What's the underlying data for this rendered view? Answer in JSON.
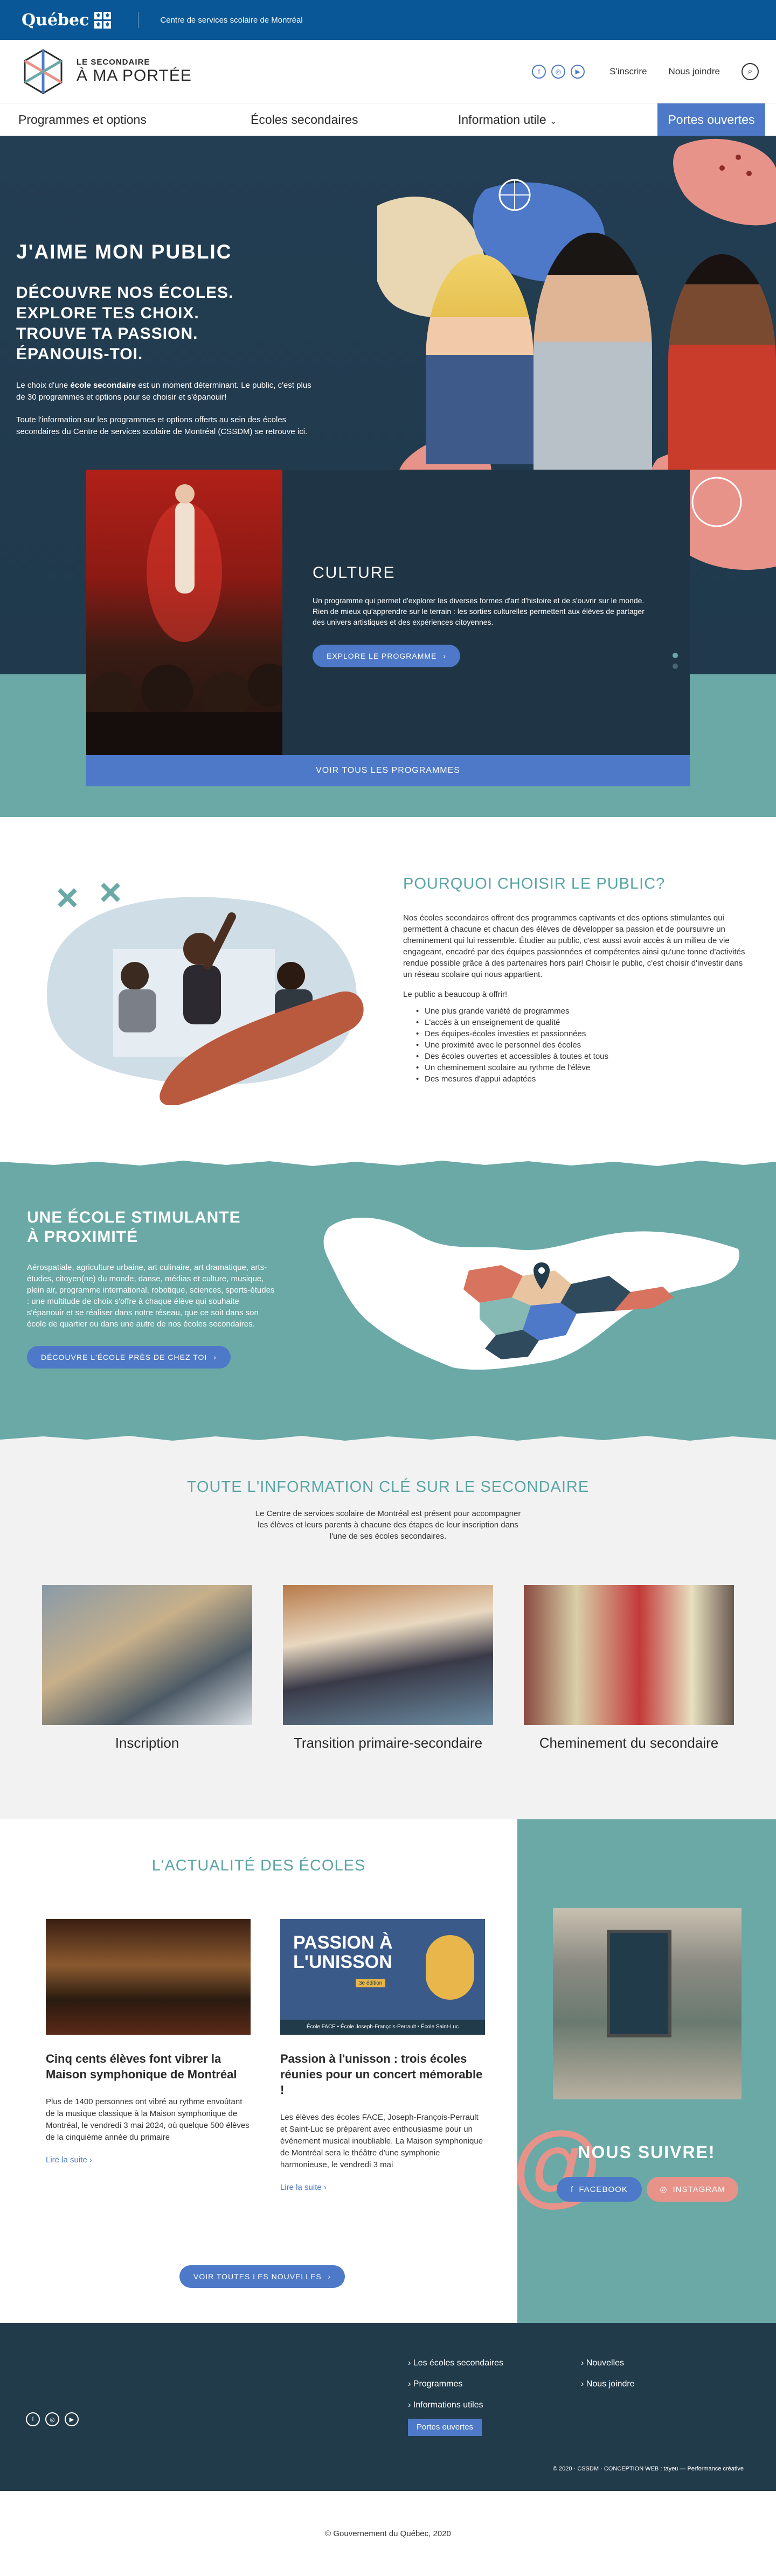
{
  "gov": {
    "logo": "Québec",
    "flag_glyph": "⚜",
    "org": "Centre de services scolaire de Montréal"
  },
  "header": {
    "logo_line1": "LE SECONDAIRE",
    "logo_line2": "À MA PORTÉE",
    "social": [
      "f",
      "◎",
      "▶"
    ],
    "signup": "S'inscrire",
    "contact": "Nous joindre"
  },
  "nav": {
    "items": [
      "Programmes et options",
      "Écoles secondaires",
      "Information utile"
    ],
    "cta": "Portes ouvertes"
  },
  "hero": {
    "title": "J'AIME MON PUBLIC",
    "sub1": "DÉCOUVRE NOS ÉCOLES.",
    "sub2": "EXPLORE TES CHOIX.",
    "sub3": "TROUVE TA PASSION.",
    "sub4": "ÉPANOUIS-TOI.",
    "p1a": "Le choix d'une ",
    "p1b": "école secondaire",
    "p1c": " est un moment déterminant. Le public, c'est plus de 30 programmes et options pour se choisir et s'épanouir!",
    "p2": "Toute l'information sur les programmes et options offerts au sein des écoles secondaires du Centre de services scolaire de Montréal (CSSDM) se retrouve ici."
  },
  "culture": {
    "title": "CULTURE",
    "text": "Un programme qui permet d'explorer les diverses formes d'art d'histoire et de s'ouvrir sur le monde. Rien de mieux qu'apprendre sur le terrain : les sorties culturelles permettent aux élèves de partager des univers artistiques et des expériences citoyennes.",
    "button": "EXPLORE LE PROGRAMME",
    "all_button": "VOIR TOUS LES PROGRAMMES"
  },
  "why": {
    "title": "POURQUOI CHOISIR LE PUBLIC?",
    "p1": "Nos écoles secondaires offrent des programmes captivants et des options stimulantes qui permettent à chacune et chacun des élèves de développer sa passion et de poursuivre un cheminement qui lui ressemble. Étudier au public, c'est aussi avoir accès à un milieu de vie engageant, encadré par des équipes passionnées et compétentes ainsi qu'une tonne d'activités rendue possible grâce à des partenaires hors pair! Choisir le public, c'est choisir d'investir dans un réseau scolaire qui nous appartient.",
    "p2": "Le public a beaucoup à offrir!",
    "list": [
      "Une plus grande variété de programmes",
      "L'accès à un enseignement de qualité",
      "Des équipes-écoles investies et passionnées",
      "Une proximité avec le personnel des écoles",
      "Des écoles ouvertes et accessibles à toutes et tous",
      "Un cheminement scolaire au rythme de l'élève",
      "Des mesures d'appui adaptées"
    ]
  },
  "prox": {
    "title1": "UNE ÉCOLE STIMULANTE",
    "title2": "À PROXIMITÉ",
    "text": "Aérospatiale, agriculture urbaine, art culinaire, art dramatique, arts-études, citoyen(ne) du monde, danse, médias et culture, musique, plein air, programme international, robotique, sciences, sports-études : une multitude de choix s'offre à chaque élève qui souhaite s'épanouir et se réaliser dans notre réseau, que ce soit dans son école de quartier ou dans une autre de nos écoles secondaires.",
    "button": "DÉCOUVRE L'ÉCOLE PRÈS DE CHEZ TOI"
  },
  "info": {
    "title": "TOUTE L'INFORMATION CLÉ SUR LE SECONDAIRE",
    "text": "Le Centre de services scolaire de Montréal est présent pour accompagner les élèves et leurs parents à chacune des étapes de leur inscription dans l'une de ses écoles secondaires.",
    "cards": [
      "Inscription",
      "Transition primaire-secondaire",
      "Cheminement du secondaire"
    ]
  },
  "news": {
    "title": "L'ACTUALITÉ DES ÉCOLES",
    "items": [
      {
        "title": "Cinq cents élèves font vibrer la Maison symphonique de Montréal",
        "text": "Plus de 1400 personnes ont vibré au rythme envoûtant de la musique classique à la Maison symphonique de Montréal, le vendredi 3 mai 2024, où quelque 500 élèves de la cinquième année du primaire",
        "more": "Lire la suite"
      },
      {
        "title": "Passion à l'unisson : trois écoles réunies pour un concert mémorable !",
        "text": "Les élèves des écoles FACE, Joseph-François-Perrault et Saint-Luc se préparent avec enthousiasme pour un événement musical inoubliable. La Maison symphonique de Montréal sera le théâtre d'une symphonie harmonieuse, le vendredi 3 mai",
        "more": "Lire la suite",
        "img_title1": "PASSION À",
        "img_title2": "L'UNISSON",
        "img_badge": "3e édition",
        "img_caption": "École FACE • École Joseph-François-Perrault • École Saint-Luc"
      }
    ],
    "all_button": "VOIR TOUTES LES NOUVELLES"
  },
  "follow": {
    "title": "NOUS SUIVRE!",
    "facebook": "FACEBOOK",
    "instagram": "INSTAGRAM"
  },
  "footer": {
    "col1": [
      "Les écoles secondaires",
      "Programmes",
      "Informations utiles"
    ],
    "cta": "Portes ouvertes",
    "col2": [
      "Nouvelles",
      "Nous joindre"
    ],
    "social": [
      "f",
      "◎",
      "▶"
    ],
    "copy": "© 2020 · CSSDM · CONCEPTION WEB : tayeu — Performance créative"
  },
  "bottom": {
    "copyright": "© Gouvernement du Québec, 2020"
  },
  "colors": {
    "gov_blue": "#095797",
    "accent": "#4d79c8",
    "teal": "#6aa9a6",
    "navy": "#223b4b",
    "coral": "#e8938a",
    "rust": "#b95a3e"
  }
}
